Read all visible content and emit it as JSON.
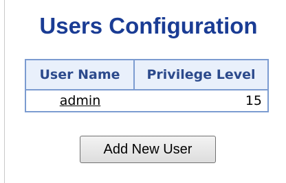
{
  "page": {
    "title": "Users Configuration"
  },
  "users_table": {
    "headers": [
      "User Name",
      "Privilege Level"
    ],
    "rows": [
      {
        "user_name": "admin",
        "privilege_level": "15"
      }
    ]
  },
  "actions": {
    "add_user_label": "Add New User"
  },
  "colors": {
    "title": "#1a3c94",
    "table_border": "#7b9bd0",
    "header_bg": "#e9f0fb",
    "header_text": "#2c4a8c"
  }
}
